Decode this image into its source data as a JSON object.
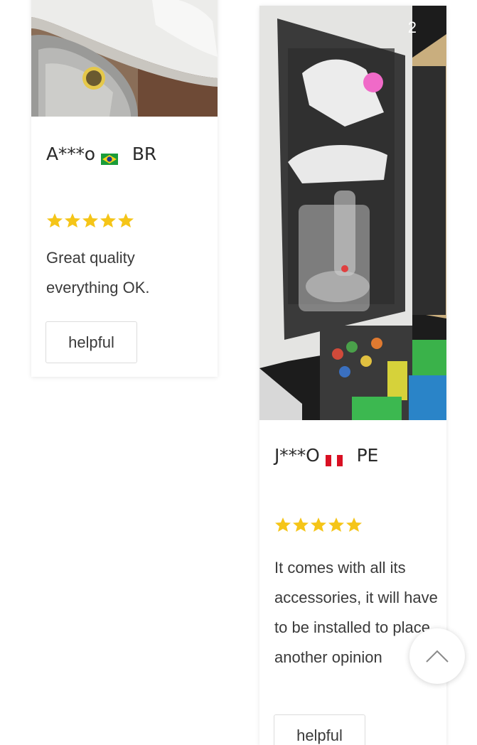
{
  "reviews": [
    {
      "author": "A***o",
      "country": "BR",
      "flag_icon": "brazil-flag-icon",
      "rating": 5,
      "text": "Great quality everything OK.",
      "helpful_label": "helpful"
    },
    {
      "author": "J***O",
      "country": "PE",
      "flag_icon": "peru-flag-icon",
      "rating": 5,
      "photo_index": "2",
      "text": "It comes with all its accessories, it will have to be installed to place another opinion",
      "helpful_label": "helpful"
    }
  ],
  "colors": {
    "star": "#f5c518",
    "card_shadow": "rgba(0,0,0,0.10)",
    "text": "#3a3a3a"
  },
  "scroll_top": {
    "icon": "chevron-up-icon"
  }
}
